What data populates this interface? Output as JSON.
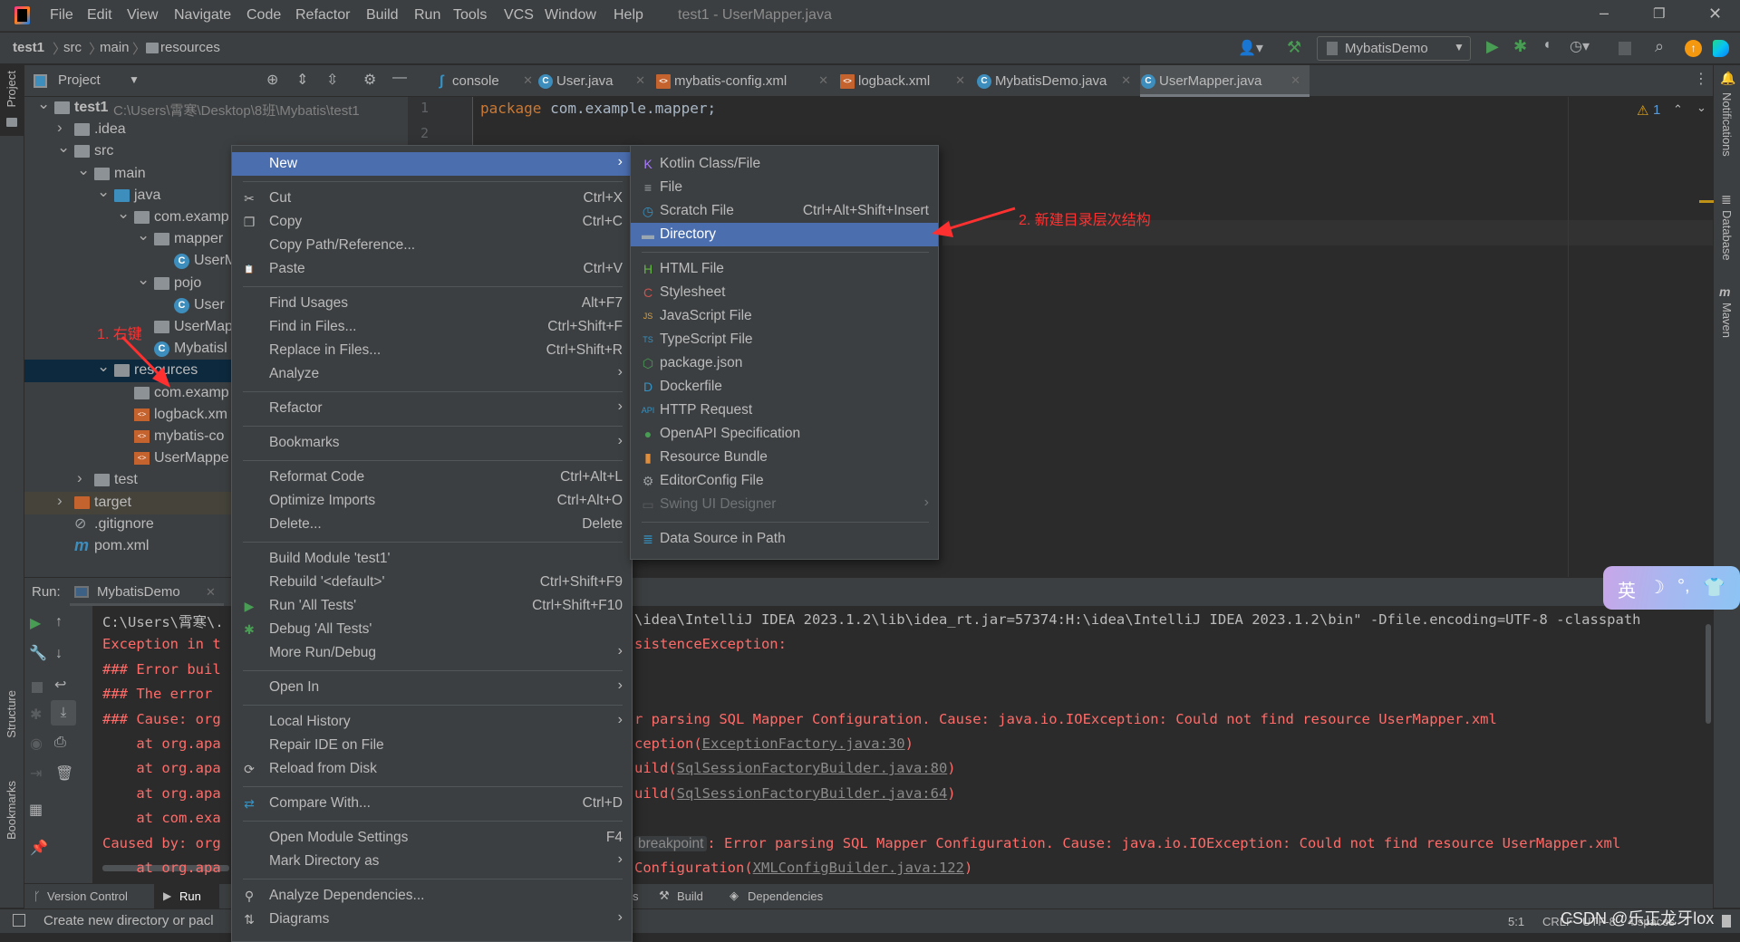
{
  "menubar": {
    "items": [
      "File",
      "Edit",
      "View",
      "Navigate",
      "Code",
      "Refactor",
      "Build",
      "Run",
      "Tools",
      "VCS",
      "Window",
      "Help"
    ],
    "title": "test1 - UserMapper.java"
  },
  "breadcrumb": [
    "test1",
    "src",
    "main",
    "resources"
  ],
  "toolbar": {
    "run_config": "MybatisDemo"
  },
  "project_panel": {
    "title": "Project",
    "strip_label": "Project",
    "tree": [
      {
        "label": "test1",
        "level": 0,
        "expanded": true,
        "icon": "module-folder",
        "path": "C:\\Users\\霄寒\\Desktop\\8班\\Mybatis\\test1"
      },
      {
        "label": ".idea",
        "level": 1,
        "expanded": false,
        "icon": "folder"
      },
      {
        "label": "src",
        "level": 1,
        "expanded": true,
        "icon": "folder"
      },
      {
        "label": "main",
        "level": 2,
        "expanded": true,
        "icon": "folder"
      },
      {
        "label": "java",
        "level": 3,
        "expanded": true,
        "icon": "source-folder"
      },
      {
        "label": "com.examp",
        "level": 4,
        "expanded": true,
        "icon": "package"
      },
      {
        "label": "mapper",
        "level": 5,
        "expanded": true,
        "icon": "package"
      },
      {
        "label": "UserM",
        "level": 6,
        "icon": "class"
      },
      {
        "label": "pojo",
        "level": 5,
        "expanded": true,
        "icon": "package"
      },
      {
        "label": "User",
        "level": 6,
        "icon": "class"
      },
      {
        "label": "UserMap",
        "level": 5,
        "icon": "package"
      },
      {
        "label": "Mybatisl",
        "level": 5,
        "icon": "run-class"
      },
      {
        "label": "resources",
        "level": 3,
        "expanded": true,
        "icon": "resources-folder",
        "selected": true
      },
      {
        "label": "com.examp",
        "level": 4,
        "icon": "folder"
      },
      {
        "label": "logback.xm",
        "level": 4,
        "icon": "xml"
      },
      {
        "label": "mybatis-co",
        "level": 4,
        "icon": "xml"
      },
      {
        "label": "UserMappe",
        "level": 4,
        "icon": "xml"
      },
      {
        "label": "test",
        "level": 2,
        "expanded": false,
        "icon": "folder"
      },
      {
        "label": "target",
        "level": 1,
        "expanded": false,
        "icon": "excluded-folder",
        "excluded": true
      },
      {
        "label": ".gitignore",
        "level": 1,
        "icon": "ignore-file"
      },
      {
        "label": "pom.xml",
        "level": 1,
        "icon": "maven"
      }
    ]
  },
  "editor": {
    "tabs": [
      {
        "label": "console",
        "icon": "console"
      },
      {
        "label": "User.java",
        "icon": "class"
      },
      {
        "label": "mybatis-config.xml",
        "icon": "xml"
      },
      {
        "label": "logback.xml",
        "icon": "xml"
      },
      {
        "label": "MybatisDemo.java",
        "icon": "run-class"
      },
      {
        "label": "UserMapper.java",
        "icon": "class",
        "active": true
      }
    ],
    "line_numbers": [
      "1",
      "2"
    ],
    "code_keyword": "package",
    "code_rest": " com.example.mapper;",
    "warnings": "1"
  },
  "right_strip": [
    "Notifications",
    "Database",
    "Maven"
  ],
  "left_strip": [
    "Structure",
    "Bookmarks"
  ],
  "run_panel": {
    "label": "Run:",
    "tab": "MybatisDemo",
    "console_left": [
      "C:\\Users\\霄寒\\.",
      "Exception in t",
      "### Error buil",
      "### The error ",
      "### Cause: org",
      "    at org.apa",
      "    at org.apa",
      "    at org.apa",
      "    at com.exa",
      "Caused by: org",
      "    at org.apa"
    ],
    "console_right": [
      {
        "text": "\\idea\\IntelliJ IDEA 2023.1.2\\lib\\idea_rt.jar=57374:H:\\idea\\IntelliJ IDEA 2023.1.2\\bin\" -Dfile.encoding=UTF-8 -classpath",
        "plain": true
      },
      {
        "text": "sistenceException:"
      },
      {
        "text": ""
      },
      {
        "text": ""
      },
      {
        "text": "r parsing SQL Mapper Configuration. Cause: java.io.IOException: Could not find resource UserMapper.xml"
      },
      {
        "text": "ception(",
        "link": "ExceptionFactory.java:30",
        "after": ")"
      },
      {
        "text": "uild(",
        "link": "SqlSessionFactoryBuilder.java:80",
        "after": ")"
      },
      {
        "text": "uild(",
        "link": "SqlSessionFactoryBuilder.java:64",
        "after": ")"
      },
      {
        "text": ""
      },
      {
        "badge": "breakpoint",
        "text": ": Error parsing SQL Mapper Configuration. Cause: java.io.IOException: Could not find resource UserMapper.xml"
      },
      {
        "text": "Configuration(",
        "link": "XMLConfigBuilder.java:122",
        "after": ")"
      }
    ]
  },
  "bottom_bar": {
    "tabs": [
      "Version Control",
      "Run"
    ],
    "tabs_right": [
      "s",
      "Build",
      "Dependencies"
    ]
  },
  "status_bar": {
    "message": "Create new directory or pacl",
    "position": "5:1",
    "line_sep": "CRLF",
    "encoding": "UTF-8",
    "indent": "4 spaces",
    "watermark": "CSDN @乐正龙牙lox"
  },
  "context_menu": {
    "items": [
      {
        "label": "New",
        "submenu": true,
        "highlighted": true
      },
      {
        "sep": true
      },
      {
        "label": "Cut",
        "shortcut": "Ctrl+X",
        "icon": "✂"
      },
      {
        "label": "Copy",
        "shortcut": "Ctrl+C",
        "icon": "❐"
      },
      {
        "label": "Copy Path/Reference..."
      },
      {
        "label": "Paste",
        "shortcut": "Ctrl+V",
        "icon": "📋"
      },
      {
        "sep": true
      },
      {
        "label": "Find Usages",
        "shortcut": "Alt+F7"
      },
      {
        "label": "Find in Files...",
        "shortcut": "Ctrl+Shift+F"
      },
      {
        "label": "Replace in Files...",
        "shortcut": "Ctrl+Shift+R"
      },
      {
        "label": "Analyze",
        "submenu": true
      },
      {
        "sep": true
      },
      {
        "label": "Refactor",
        "submenu": true
      },
      {
        "sep": true
      },
      {
        "label": "Bookmarks",
        "submenu": true
      },
      {
        "sep": true
      },
      {
        "label": "Reformat Code",
        "shortcut": "Ctrl+Alt+L"
      },
      {
        "label": "Optimize Imports",
        "shortcut": "Ctrl+Alt+O"
      },
      {
        "label": "Delete...",
        "shortcut": "Delete"
      },
      {
        "sep": true
      },
      {
        "label": "Build Module 'test1'"
      },
      {
        "label": "Rebuild '<default>'",
        "shortcut": "Ctrl+Shift+F9"
      },
      {
        "label": "Run 'All Tests'",
        "shortcut": "Ctrl+Shift+F10",
        "icon": "▶",
        "icon_color": "#499c54"
      },
      {
        "label": "Debug 'All Tests'",
        "icon": "✱",
        "icon_color": "#499c54"
      },
      {
        "label": "More Run/Debug",
        "submenu": true
      },
      {
        "sep": true
      },
      {
        "label": "Open In",
        "submenu": true
      },
      {
        "sep": true
      },
      {
        "label": "Local History",
        "submenu": true
      },
      {
        "label": "Repair IDE on File"
      },
      {
        "label": "Reload from Disk",
        "icon": "⟳"
      },
      {
        "sep": true
      },
      {
        "label": "Compare With...",
        "shortcut": "Ctrl+D",
        "icon": "⇄",
        "icon_color": "#3592c4"
      },
      {
        "sep": true
      },
      {
        "label": "Open Module Settings",
        "shortcut": "F4"
      },
      {
        "label": "Mark Directory as",
        "submenu": true
      },
      {
        "sep": true
      },
      {
        "label": "Analyze Dependencies...",
        "icon": "⚲"
      },
      {
        "label": "Diagrams",
        "submenu": true,
        "icon": "⇅"
      }
    ]
  },
  "new_submenu": {
    "items": [
      {
        "label": "Kotlin Class/File",
        "icon": "K",
        "icon_color": "#a97bff"
      },
      {
        "label": "File",
        "icon": "≡",
        "icon_color": "#9aa0a4"
      },
      {
        "label": "Scratch File",
        "shortcut": "Ctrl+Alt+Shift+Insert",
        "icon": "◷",
        "icon_color": "#3592c4"
      },
      {
        "label": "Directory",
        "highlighted": true,
        "icon": "▬",
        "icon_color": "#9aa7b0"
      },
      {
        "sep": true
      },
      {
        "label": "HTML File",
        "icon": "H",
        "icon_color": "#62b543"
      },
      {
        "label": "Stylesheet",
        "icon": "C",
        "icon_color": "#c75450"
      },
      {
        "label": "JavaScript File",
        "icon": "JS",
        "icon_color": "#d9a343"
      },
      {
        "label": "TypeScript File",
        "icon": "TS",
        "icon_color": "#3592c4"
      },
      {
        "label": "package.json",
        "icon": "⬡",
        "icon_color": "#499c54"
      },
      {
        "label": "Dockerfile",
        "icon": "D",
        "icon_color": "#3592c4"
      },
      {
        "label": "HTTP Request",
        "icon": "API",
        "icon_color": "#3592c4"
      },
      {
        "label": "OpenAPI Specification",
        "icon": "●",
        "icon_color": "#499c54"
      },
      {
        "label": "Resource Bundle",
        "icon": "▮",
        "icon_color": "#e08e3b"
      },
      {
        "label": "EditorConfig File",
        "icon": "⚙",
        "icon_color": "#9aa0a4"
      },
      {
        "label": "Swing UI Designer",
        "submenu": true,
        "disabled": true,
        "icon": "▭",
        "icon_color": "#5a5d5f"
      },
      {
        "sep": true
      },
      {
        "label": "Data Source in Path",
        "icon": "≣",
        "icon_color": "#3592c4"
      }
    ]
  },
  "annotations": {
    "step1": "1. 右键",
    "step2": "2. 新建目录层次结构",
    "color": "#ff3030"
  },
  "colors": {
    "menu_highlight": "#4b6eaf",
    "panel_bg": "#3c3f41",
    "editor_bg": "#2b2b2b",
    "error_red": "#ff6b68"
  }
}
